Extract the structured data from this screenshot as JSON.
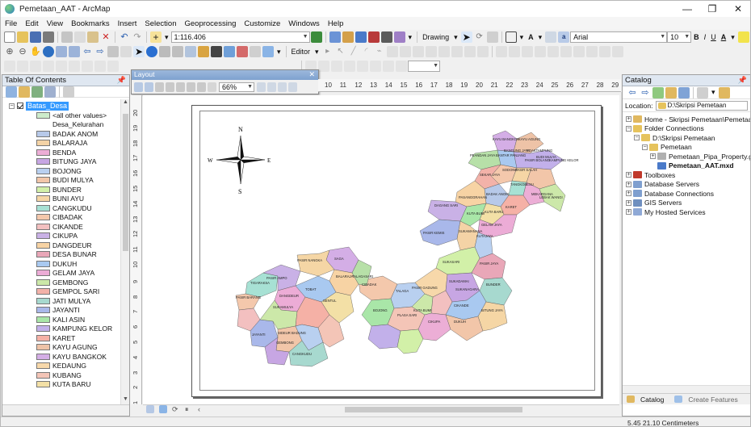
{
  "window": {
    "title": "Pemetaan_AAT - ArcMap"
  },
  "menu": [
    "File",
    "Edit",
    "View",
    "Bookmarks",
    "Insert",
    "Selection",
    "Geoprocessing",
    "Customize",
    "Windows",
    "Help"
  ],
  "toolbar": {
    "scale": "1:116.406",
    "drawing_label": "Drawing",
    "font_name": "Arial",
    "font_size": "10",
    "bold": "B",
    "italic": "I",
    "underline": "U",
    "text_a": "A",
    "editor_label": "Editor"
  },
  "toc": {
    "title": "Table Of Contents",
    "layer_name": "Batas_Desa",
    "other_values": "<all other values>",
    "field_heading": "Desa_Kelurahan",
    "classes": [
      {
        "name": "BADAK ANOM",
        "color": "#b7c9e9"
      },
      {
        "name": "BALARAJA",
        "color": "#f4d3a6"
      },
      {
        "name": "BENDA",
        "color": "#ecaed6"
      },
      {
        "name": "BITUNG JAYA",
        "color": "#c7a6e3"
      },
      {
        "name": "BOJONG",
        "color": "#b9d0f0"
      },
      {
        "name": "BUDI MULYA",
        "color": "#f2c6a9"
      },
      {
        "name": "BUNDER",
        "color": "#d2f0a8"
      },
      {
        "name": "BUNI AYU",
        "color": "#f5d6a5"
      },
      {
        "name": "CANGKUDU",
        "color": "#a7e1d4"
      },
      {
        "name": "CIBADAK",
        "color": "#f4c8ac"
      },
      {
        "name": "CIKANDE",
        "color": "#f3c0c0"
      },
      {
        "name": "CIKUPA",
        "color": "#c9b1e6"
      },
      {
        "name": "DANGDEUR",
        "color": "#f7d3a4"
      },
      {
        "name": "DESA BUNAR",
        "color": "#e9a7b8"
      },
      {
        "name": "DUKUH",
        "color": "#a9c9f0"
      },
      {
        "name": "GELAM JAYA",
        "color": "#ecacd6"
      },
      {
        "name": "GEMBONG",
        "color": "#cce8a9"
      },
      {
        "name": "GEMPOL SARI",
        "color": "#f3b2a9"
      },
      {
        "name": "JATI MULYA",
        "color": "#a7d9cf"
      },
      {
        "name": "JAYANTI",
        "color": "#a9b8ea"
      },
      {
        "name": "KALI ASIN",
        "color": "#a9e6a8"
      },
      {
        "name": "KAMPUNG KELOR",
        "color": "#c2b0ea"
      },
      {
        "name": "KARET",
        "color": "#f5b1a6"
      },
      {
        "name": "KAYU AGUNG",
        "color": "#eec3a7"
      },
      {
        "name": "KAYU BANGKOK",
        "color": "#d4aee6"
      },
      {
        "name": "KEDAUNG",
        "color": "#f7d8aa"
      },
      {
        "name": "KUBANG",
        "color": "#f4c5b7"
      },
      {
        "name": "KUTA BARU",
        "color": "#f3e0a6"
      }
    ]
  },
  "layout_toolbar": {
    "title": "Layout",
    "zoom": "66%"
  },
  "ruler": {
    "h": [
      "10",
      "11",
      "12",
      "13",
      "14",
      "15",
      "16",
      "17",
      "18",
      "19",
      "20",
      "21",
      "22",
      "23",
      "24",
      "25",
      "26",
      "27",
      "28",
      "29"
    ],
    "v": [
      "20",
      "19",
      "18",
      "17",
      "16",
      "15",
      "14",
      "13",
      "12",
      "11",
      "10",
      "9",
      "8",
      "7",
      "6",
      "5",
      "4",
      "3",
      "2",
      "1"
    ]
  },
  "map": {
    "north": "N",
    "south": "S",
    "east": "E",
    "west": "W",
    "labels": [
      "KAYU BANGKOK",
      "KAYU AGUNG",
      "PEANDAN JAYA",
      "BANTAR PANJANG",
      "BANGUNG JAYA",
      "KOAKTAMPUNG",
      "PASIR BOLANG",
      "BUDI MULYA",
      "KAMPUNG KELOR",
      "PASIR SALAH",
      "SODONG",
      "SEKAR JAYA",
      "TANGKOBESU",
      "PASANGGRAHAN",
      "BADAK ANOM",
      "MEKARGANA",
      "LEBAK WANGI",
      "DAGANG SARI",
      "KARET",
      "KUTA BARU",
      "KUTA BUMI",
      "GELAM JAYA",
      "PASIR KEMIS",
      "SUKAMANANA",
      "KUTAJAYA",
      "SUKASARI",
      "PASIR JAYA",
      "BUNDER",
      "CIBADAK",
      "TALAGA",
      "PASIR GADUNG",
      "SUKADAMAI",
      "SUKANAGARA",
      "BOJONG",
      "PLASA SARI",
      "KUTA BUMI",
      "CIKUPA",
      "CIKANDE",
      "DUKUH",
      "BITUNG JAYA",
      "SAGA",
      "PASIR NANGKA",
      "TIGARAKSA",
      "BALARAJA",
      "TALAGASARI",
      "PASIR BARANG",
      "PASIR AMPO",
      "DANGDEUR",
      "TOBAT",
      "JAYANTI",
      "SUKAMULYA",
      "GEMBONG",
      "SENTUL",
      "CANGKUDU",
      "SIDEUR BADUNG"
    ]
  },
  "catalog": {
    "title": "Catalog",
    "location_label": "Location:",
    "location_value": "D:\\Skripsi Pemetaan",
    "tree": [
      {
        "label": "Home - Skripsi Pemetaan\\Pemetaan",
        "indent": 0,
        "pm": "+",
        "icon": "home"
      },
      {
        "label": "Folder Connections",
        "indent": 0,
        "pm": "−",
        "icon": "folder"
      },
      {
        "label": "D:\\Skripsi Pemetaan",
        "indent": 1,
        "pm": "−",
        "icon": "folder"
      },
      {
        "label": "Pemetaan",
        "indent": 2,
        "pm": "−",
        "icon": "folder"
      },
      {
        "label": "Pemetaan_Pipa_Property.gdb",
        "indent": 3,
        "pm": "+",
        "icon": "gdb"
      },
      {
        "label": "Pemetaan_AAT.mxd",
        "indent": 3,
        "pm": "",
        "icon": "mxd",
        "bold": true
      },
      {
        "label": "Toolboxes",
        "indent": 0,
        "pm": "+",
        "icon": "toolbox"
      },
      {
        "label": "Database Servers",
        "indent": 0,
        "pm": "+",
        "icon": "db"
      },
      {
        "label": "Database Connections",
        "indent": 0,
        "pm": "+",
        "icon": "db"
      },
      {
        "label": "GIS Servers",
        "indent": 0,
        "pm": "+",
        "icon": "gis"
      },
      {
        "label": "My Hosted Services",
        "indent": 0,
        "pm": "+",
        "icon": "cloud"
      }
    ],
    "tab_catalog": "Catalog",
    "tab_create_features": "Create Features"
  },
  "status": {
    "coords": "5.45  21.10 Centimeters"
  },
  "colors": {
    "selection": "#3399ff",
    "panel_header": "#dfe7f1"
  }
}
